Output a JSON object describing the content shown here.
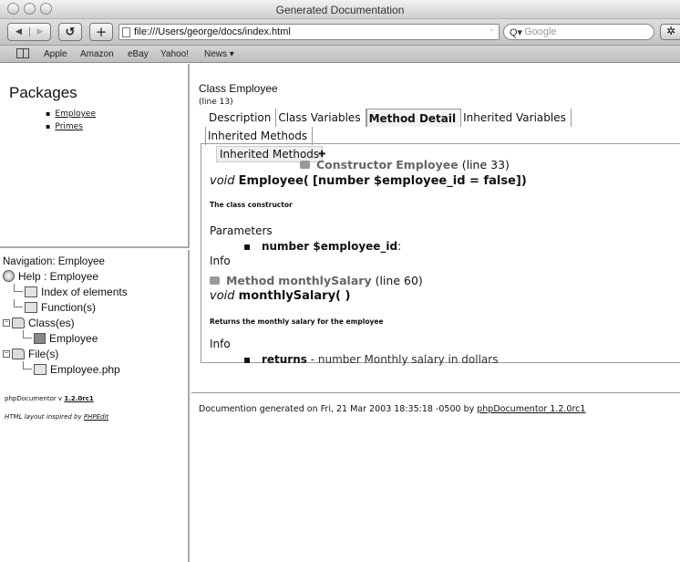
{
  "window": {
    "title": "Generated Documentation"
  },
  "toolbar": {
    "back_glyph": "◀",
    "forward_glyph": "▶",
    "reload_glyph": "↺",
    "add_glyph": "+",
    "url": "file:///Users/george/docs/index.html",
    "search_placeholder": "Google",
    "search_icon": "Q▾",
    "gear_glyph": "✲"
  },
  "bookmarks": {
    "items": [
      "Apple",
      "Amazon",
      "eBay",
      "Yahoo!",
      "News ▾"
    ]
  },
  "packages": {
    "title": "Packages",
    "items": [
      "Employee",
      "Primes"
    ]
  },
  "navigation": {
    "title": "Navigation: Employee",
    "help": "Help : Employee",
    "index": "Index of elements",
    "functions": "Function(s)",
    "classes": "Class(es)",
    "class_item": "Employee",
    "files": "File(s)",
    "file_item": "Employee.php",
    "credit_prefix": "phpDocumentor v ",
    "credit_version": "1.2.0rc1",
    "layout_prefix": "HTML layout inspired by ",
    "layout_link": "PHPEdit"
  },
  "main": {
    "class_title": "Class Employee",
    "class_line": "(line 13)",
    "tabs": [
      "Description",
      "Class Variables",
      "Method Detail",
      "Inherited Variables",
      "Inherited Methods"
    ],
    "subtab": "Inherited Methods",
    "constructor": {
      "kind": "Constructor",
      "name": "Employee",
      "line": "(line 33)",
      "sig_type": "void",
      "sig_name": "Employee(",
      "sig_params": "[number $employee_id = false]",
      "sig_close": ")",
      "description": "The class constructor",
      "params_label": "Parameters",
      "param": "number $employee_id",
      "param_suffix": ":",
      "info_label": "Info"
    },
    "method": {
      "kind": "Method",
      "name": "monthlySalary",
      "line": "(line 60)",
      "sig_type": "void",
      "sig_name": "monthlySalary( )",
      "description": "Returns the monthly salary for the employee",
      "info_label": "Info",
      "returns_label": "returns",
      "returns_text": "- number Monthly salary in dollars"
    },
    "footer_prefix": "Documention generated on Fri, 21 Mar 2003 18:35:18 -0500 by ",
    "footer_link": "phpDocumentor 1.2.0rc1"
  }
}
